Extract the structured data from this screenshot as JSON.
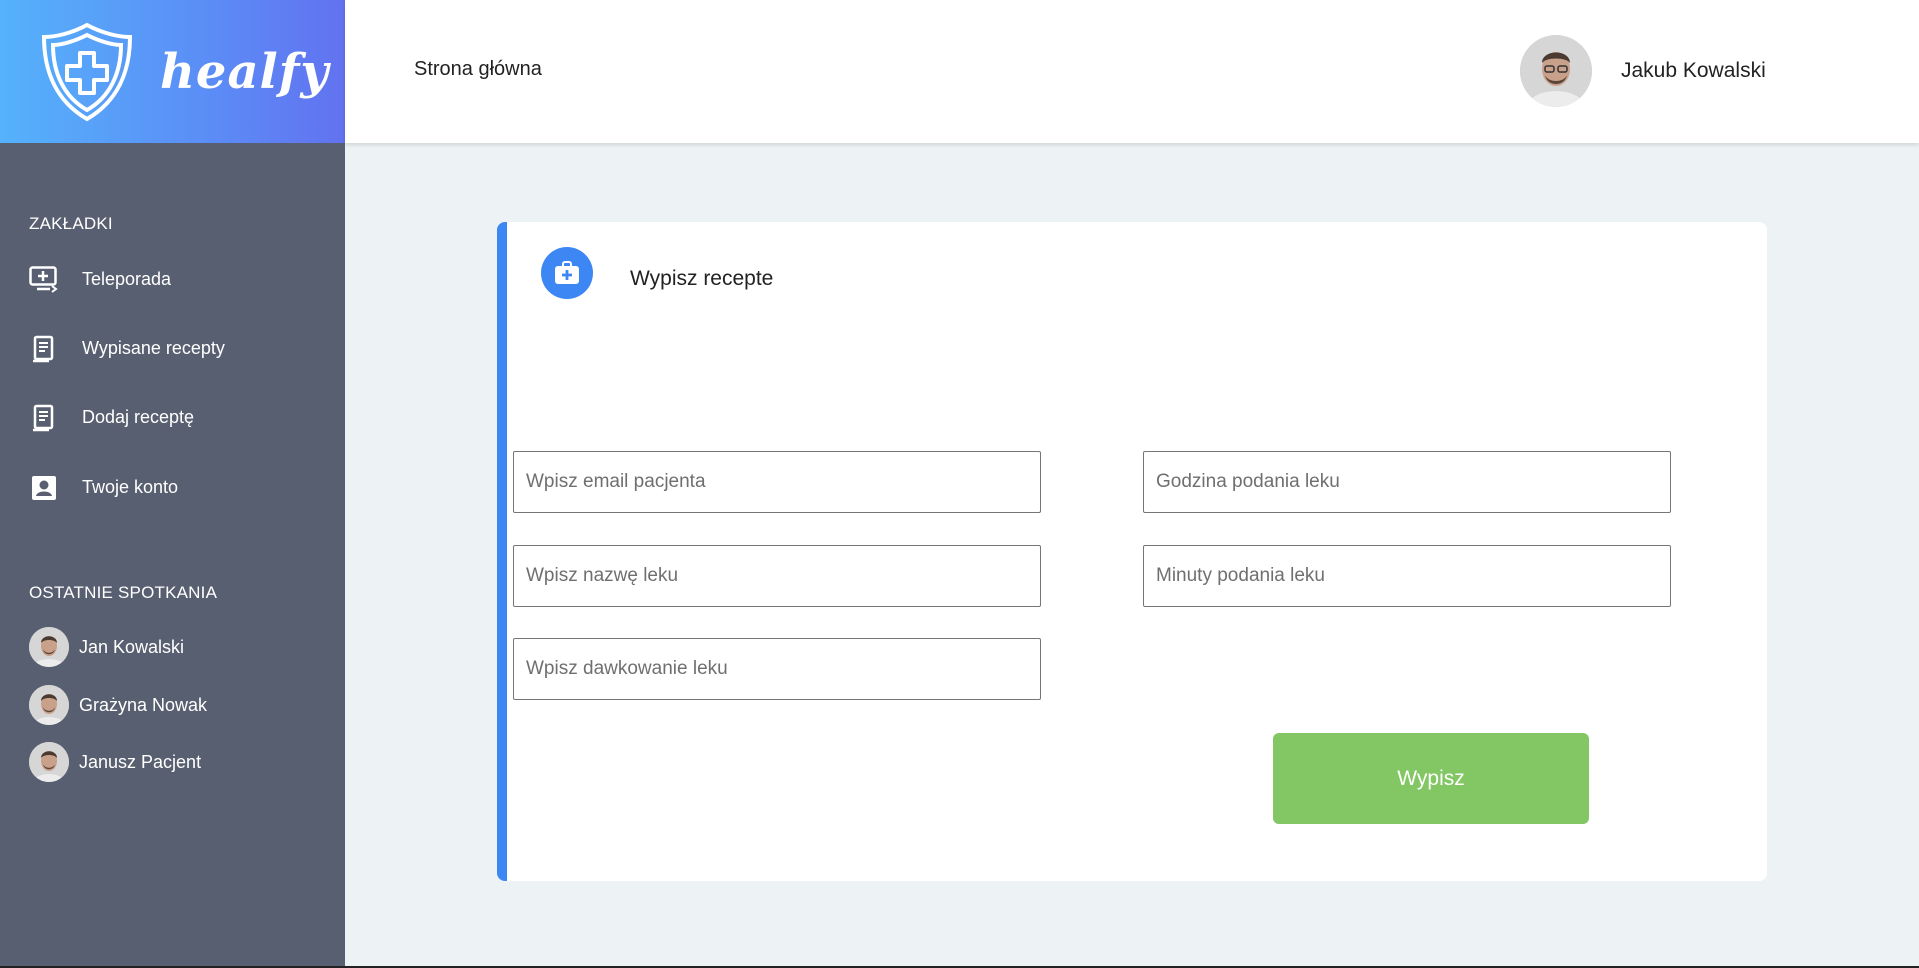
{
  "brand": {
    "name": "healfy"
  },
  "header": {
    "nav_home": "Strona główna",
    "user_name": "Jakub Kowalski"
  },
  "sidebar": {
    "tabs_title": "ZAKŁADKI",
    "items": [
      {
        "label": "Teleporada",
        "icon": "telemedicine-icon"
      },
      {
        "label": "Wypisane recepty",
        "icon": "prescription-list-icon"
      },
      {
        "label": "Dodaj receptę",
        "icon": "prescription-add-icon"
      },
      {
        "label": "Twoje konto",
        "icon": "account-icon"
      }
    ],
    "recent_title": "OSTATNIE SPOTKANIA",
    "recent": [
      {
        "name": "Jan Kowalski"
      },
      {
        "name": "Grażyna Nowak"
      },
      {
        "name": "Janusz Pacjent"
      }
    ]
  },
  "form": {
    "title": "Wypisz recepte",
    "icon": "medical-kit-icon",
    "fields": {
      "patient_email": {
        "placeholder": "Wpisz email pacjenta",
        "value": ""
      },
      "drug_name": {
        "placeholder": "Wpisz nazwę leku",
        "value": ""
      },
      "dosage": {
        "placeholder": "Wpisz dawkowanie leku",
        "value": ""
      },
      "hour": {
        "placeholder": "Godzina podania leku",
        "value": ""
      },
      "minutes": {
        "placeholder": "Minuty podania leku",
        "value": ""
      }
    },
    "submit_label": "Wypisz"
  },
  "colors": {
    "accent_blue": "#3d87f5",
    "sidebar_bg": "#585f70",
    "submit_green": "#82c764",
    "page_bg": "#edf2f5"
  }
}
